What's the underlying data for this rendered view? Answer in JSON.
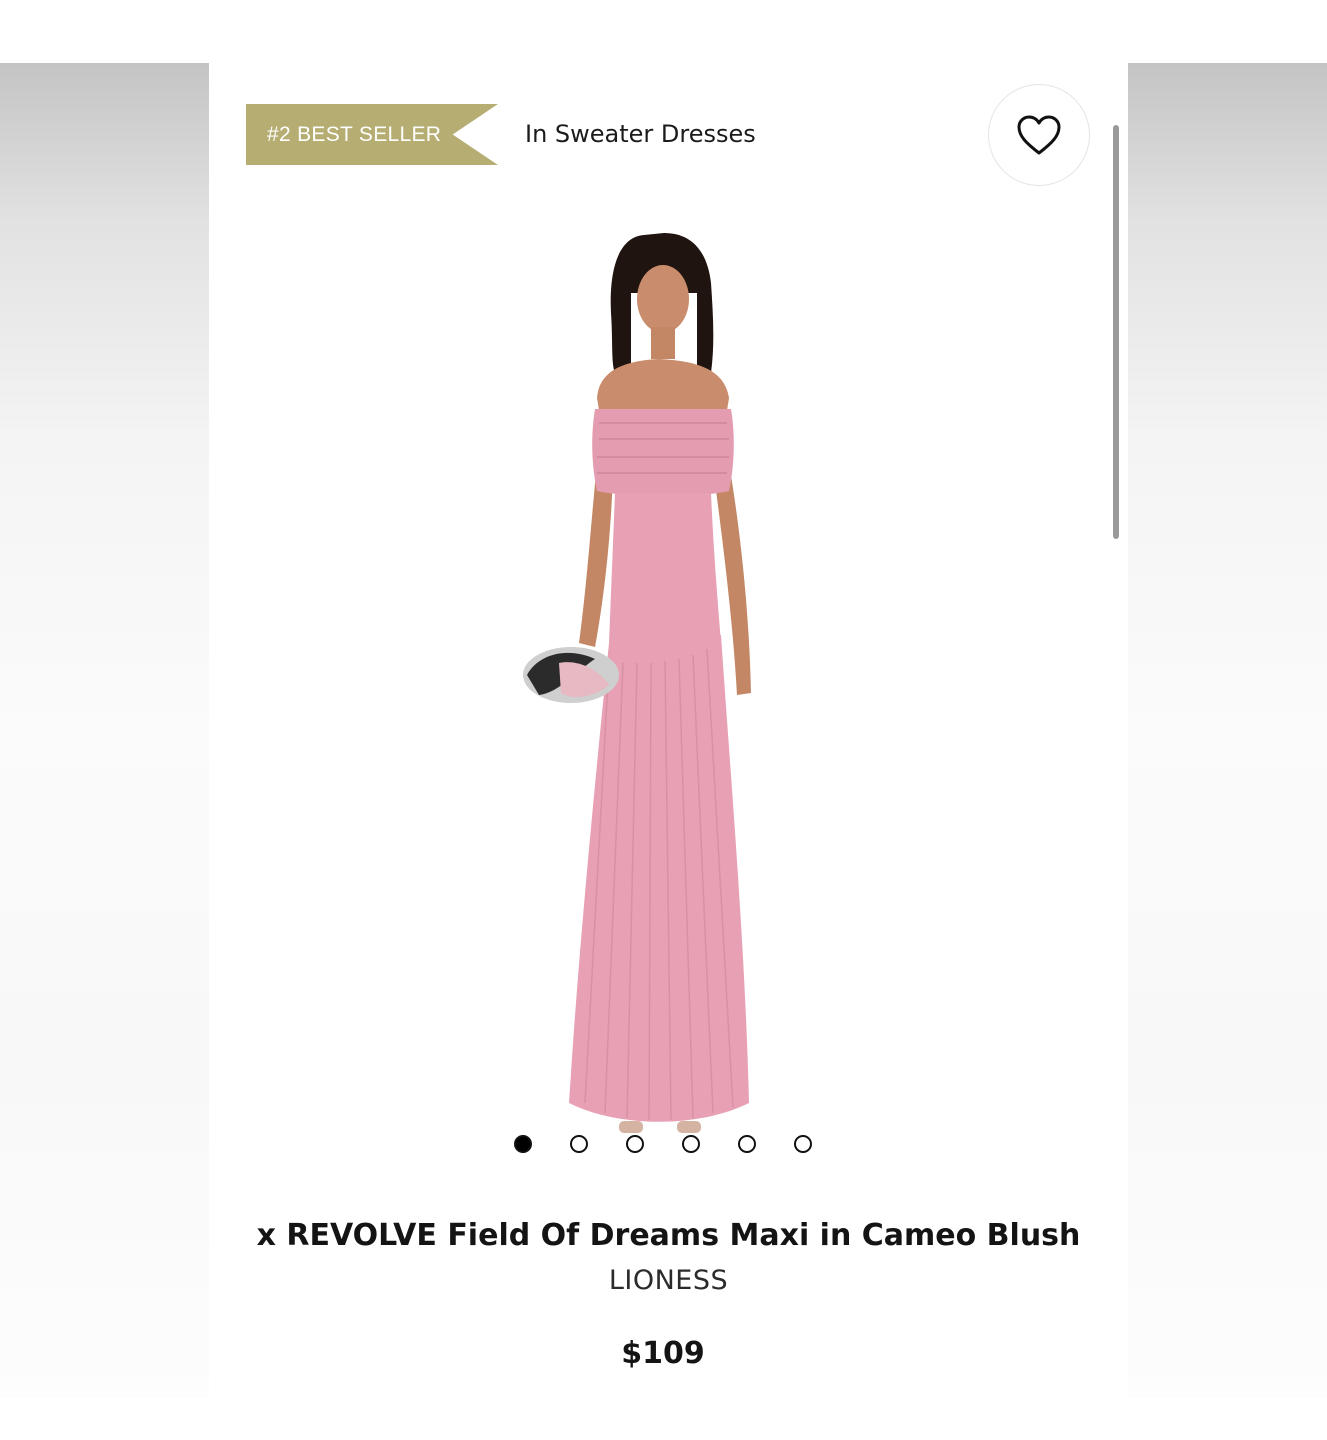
{
  "badge": {
    "label": "#2 BEST SELLER",
    "context": "In Sweater Dresses",
    "color": "#b5ad72"
  },
  "wishlist": {
    "icon": "heart-outline-icon"
  },
  "product": {
    "image_alt": "Model wearing pink off-the-shoulder pleated maxi dress holding a clutch",
    "dress_color": "#e7a0b4",
    "title": "x REVOLVE Field Of Dreams Maxi in Cameo Blush",
    "brand": "LIONESS",
    "price": "$109"
  },
  "carousel": {
    "total": 6,
    "active_index": 0
  }
}
